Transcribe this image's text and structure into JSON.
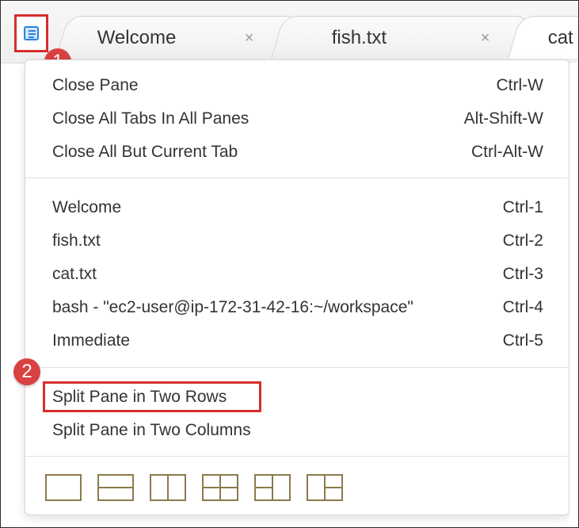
{
  "tabs": [
    {
      "label": "Welcome",
      "close": "×"
    },
    {
      "label": "fish.txt",
      "close": "×"
    },
    {
      "label": "cat"
    }
  ],
  "menu": {
    "group1": [
      {
        "label": "Close Pane",
        "shortcut": "Ctrl-W"
      },
      {
        "label": "Close All Tabs In All Panes",
        "shortcut": "Alt-Shift-W"
      },
      {
        "label": "Close All But Current Tab",
        "shortcut": "Ctrl-Alt-W"
      }
    ],
    "group2": [
      {
        "label": "Welcome",
        "shortcut": "Ctrl-1"
      },
      {
        "label": "fish.txt",
        "shortcut": "Ctrl-2"
      },
      {
        "label": "cat.txt",
        "shortcut": "Ctrl-3"
      },
      {
        "label": "bash - \"ec2-user@ip-172-31-42-16:~/workspace\"",
        "shortcut": "Ctrl-4"
      },
      {
        "label": "Immediate",
        "shortcut": "Ctrl-5"
      }
    ],
    "group3": [
      {
        "label": "Split Pane in Two Rows"
      },
      {
        "label": "Split Pane in Two Columns"
      }
    ]
  },
  "badges": {
    "one": "1",
    "two": "2"
  },
  "icons": {
    "menu": "list-menu-icon",
    "layout_single": "single-pane-layout-icon",
    "layout_rows": "two-rows-layout-icon",
    "layout_columns": "two-columns-layout-icon",
    "layout_grid": "grid-layout-icon",
    "layout_left_split": "left-split-layout-icon",
    "layout_right_split": "right-split-layout-icon"
  },
  "colors": {
    "highlight": "#d72d2d",
    "badge": "#d94141",
    "menu_icon": "#2f7ee0",
    "layout_icon": "#8b7a4b"
  }
}
